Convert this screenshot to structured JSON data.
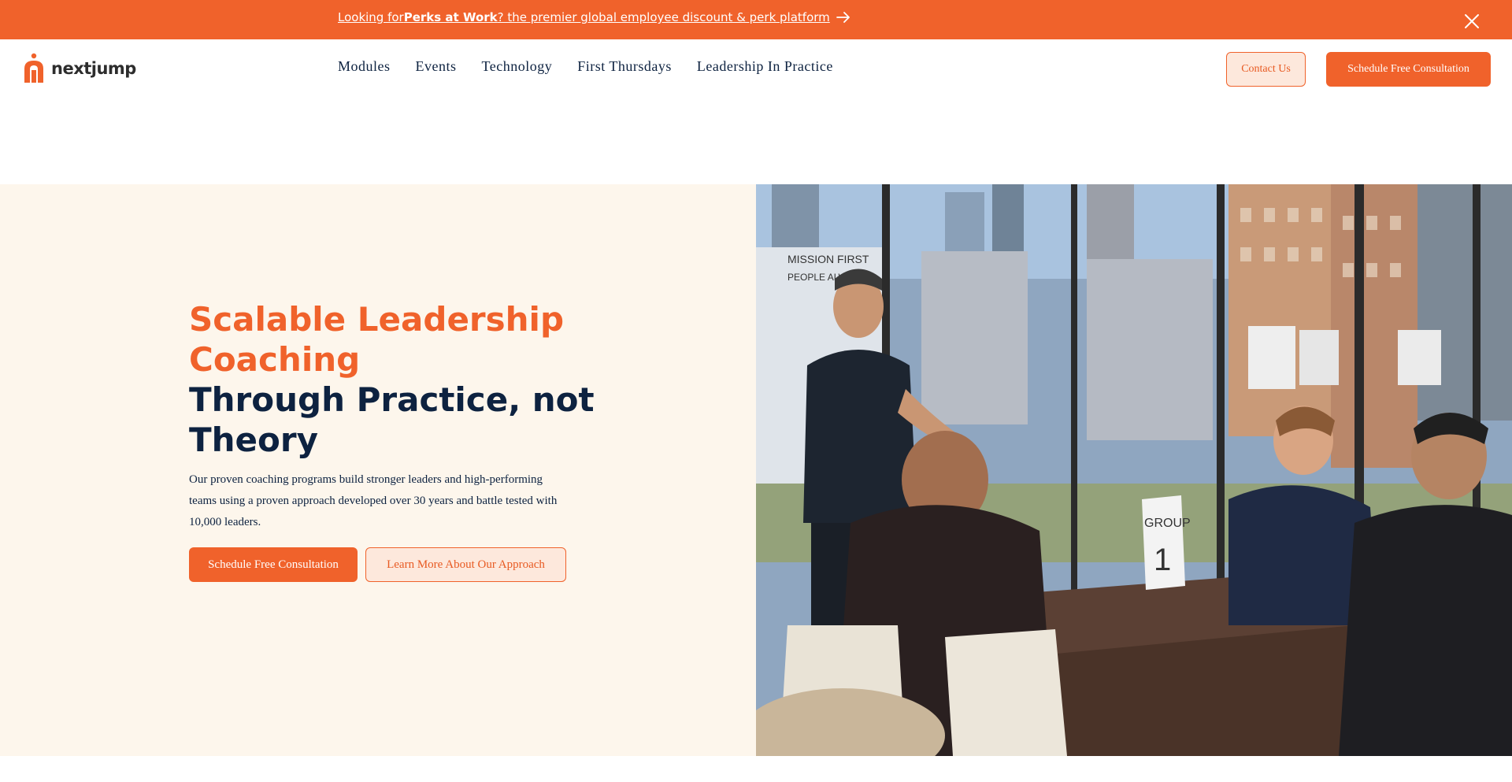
{
  "announcement": {
    "prefix": "Looking for ",
    "bold": "Perks at Work",
    "suffix": "? the premier global employee discount & perk platform",
    "arrow_icon": "arrow-right-icon",
    "close_icon": "close-icon"
  },
  "header": {
    "logo_text": "nextjump",
    "nav": [
      "Modules",
      "Events",
      "Technology",
      "First Thursdays",
      "Leadership In Practice"
    ],
    "contact_label": "Contact Us",
    "schedule_label": "Schedule Free Consultation"
  },
  "hero": {
    "headline_accent_line1": "Scalable Leadership",
    "headline_accent_line2": "Coaching",
    "headline_dark_line1": "Through Practice, not",
    "headline_dark_line2": "Theory",
    "description": "Our proven coaching programs build stronger leaders and high-performing teams using a proven approach developed over 30 years and battle tested with 10,000 leaders.",
    "primary_button": "Schedule Free Consultation",
    "secondary_button": "Learn More About Our Approach",
    "photo": {
      "whiteboard_line1": "MISSION FIRST",
      "whiteboard_line2": "PEOPLE ALWAYS",
      "table_card_label": "GROUP",
      "table_card_number": "1"
    }
  },
  "colors": {
    "brand_orange": "#f0622b",
    "navy": "#0d2240",
    "cream": "#fdf6ec",
    "light_orange": "#fde8dc"
  }
}
